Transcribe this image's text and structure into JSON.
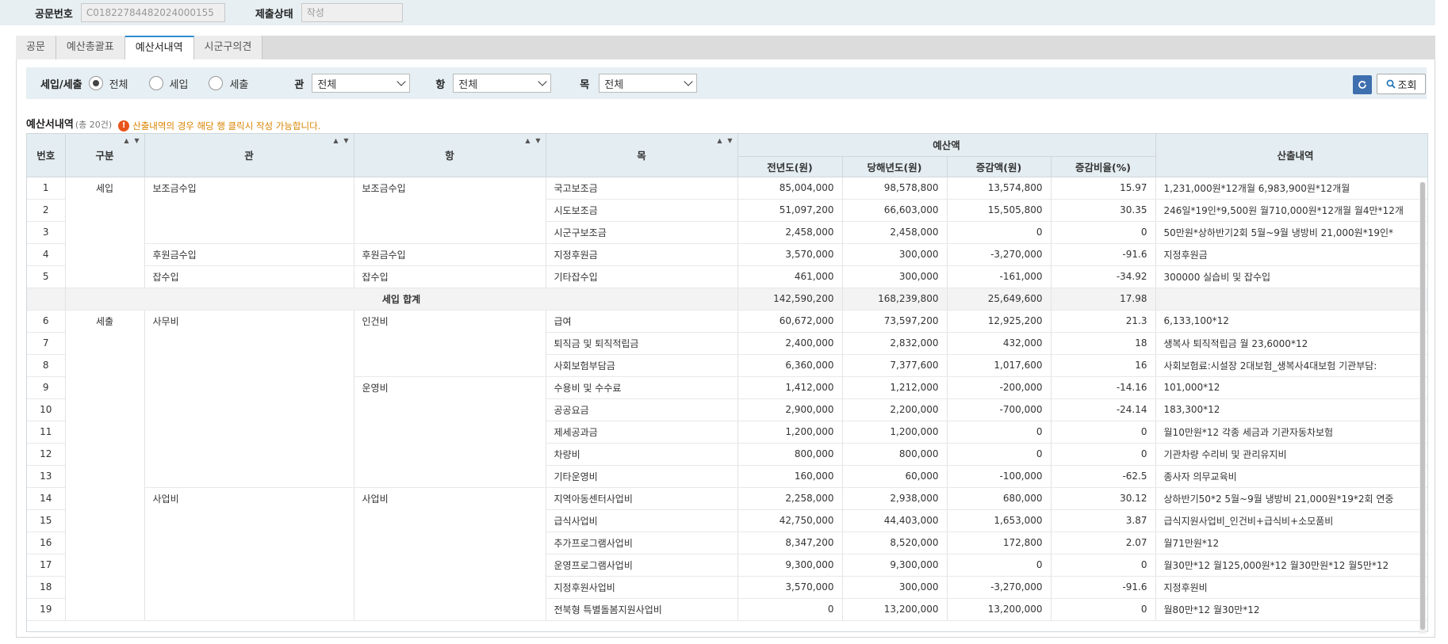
{
  "header": {
    "doc_label": "공문번호",
    "doc_value": "C01822784482024000155",
    "status_label": "제출상태",
    "status_value": "작성"
  },
  "tabs": [
    {
      "label": "공문",
      "active": false
    },
    {
      "label": "예산총괄표",
      "active": false
    },
    {
      "label": "예산서내역",
      "active": true
    },
    {
      "label": "시군구의견",
      "active": false
    }
  ],
  "filter": {
    "type_label": "세입/세출",
    "radios": [
      {
        "label": "전체",
        "checked": true
      },
      {
        "label": "세입",
        "checked": false
      },
      {
        "label": "세출",
        "checked": false
      }
    ],
    "gwan_label": "관",
    "gwan_value": "전체",
    "hang_label": "항",
    "hang_value": "전체",
    "mok_label": "목",
    "mok_value": "전체",
    "search_label": "조회"
  },
  "section": {
    "title": "예산서내역",
    "count": "(총 20건)",
    "notice": "산출내역의 경우 해당 행 클릭시 작성 가능합니다."
  },
  "grid": {
    "columns": {
      "no": "번호",
      "gubun": "구분",
      "gwan": "관",
      "hang": "항",
      "mok": "목",
      "budget": "예산액",
      "prev": "전년도(원)",
      "curr": "당해년도(원)",
      "diff": "증감액(원)",
      "rate": "증감비율(%)",
      "detail": "산출내역"
    },
    "subtotal_label": "세입 합계",
    "rows": [
      {
        "no": "1",
        "gubun": "세입",
        "gwan": "보조금수입",
        "hang": "보조금수입",
        "mok": "국고보조금",
        "prev": "85,004,000",
        "curr": "98,578,800",
        "diff": "13,574,800",
        "rate": "15.97",
        "detail": "1,231,000원*12개월 6,983,900원*12개월"
      },
      {
        "no": "2",
        "gubun": "",
        "gwan": "",
        "hang": "",
        "mok": "시도보조금",
        "prev": "51,097,200",
        "curr": "66,603,000",
        "diff": "15,505,800",
        "rate": "30.35",
        "detail": "246일*19인*9,500원 월710,000원*12개월 월4만*12개"
      },
      {
        "no": "3",
        "gubun": "",
        "gwan": "",
        "hang": "",
        "mok": "시군구보조금",
        "prev": "2,458,000",
        "curr": "2,458,000",
        "diff": "0",
        "rate": "0",
        "detail": "50만원*상하반기2회 5월~9월 냉방비 21,000원*19인*"
      },
      {
        "no": "4",
        "gubun": "",
        "gwan": "후원금수입",
        "hang": "후원금수입",
        "mok": "지정후원금",
        "prev": "3,570,000",
        "curr": "300,000",
        "diff": "-3,270,000",
        "rate": "-91.6",
        "detail": "지정후원금"
      },
      {
        "no": "5",
        "gubun": "",
        "gwan": "잡수입",
        "hang": "잡수입",
        "mok": "기타잡수입",
        "prev": "461,000",
        "curr": "300,000",
        "diff": "-161,000",
        "rate": "-34.92",
        "detail": "300000 실습비 및 잡수입"
      },
      {
        "subtotal": true,
        "prev": "142,590,200",
        "curr": "168,239,800",
        "diff": "25,649,600",
        "rate": "17.98",
        "detail": ""
      },
      {
        "no": "6",
        "gubun": "세출",
        "gwan": "사무비",
        "hang": "인건비",
        "mok": "급여",
        "prev": "60,672,000",
        "curr": "73,597,200",
        "diff": "12,925,200",
        "rate": "21.3",
        "detail": "6,133,100*12"
      },
      {
        "no": "7",
        "gubun": "",
        "gwan": "",
        "hang": "",
        "mok": "퇴직금 및 퇴직적립금",
        "prev": "2,400,000",
        "curr": "2,832,000",
        "diff": "432,000",
        "rate": "18",
        "detail": "생복사 퇴직적립금 월 23,6000*12"
      },
      {
        "no": "8",
        "gubun": "",
        "gwan": "",
        "hang": "",
        "mok": "사회보험부담금",
        "prev": "6,360,000",
        "curr": "7,377,600",
        "diff": "1,017,600",
        "rate": "16",
        "detail": "사회보험료:시설장 2대보험_생복사4대보험 기관부담:"
      },
      {
        "no": "9",
        "gubun": "",
        "gwan": "",
        "hang": "운영비",
        "mok": "수용비 및 수수료",
        "prev": "1,412,000",
        "curr": "1,212,000",
        "diff": "-200,000",
        "rate": "-14.16",
        "detail": "101,000*12"
      },
      {
        "no": "10",
        "gubun": "",
        "gwan": "",
        "hang": "",
        "mok": "공공요금",
        "prev": "2,900,000",
        "curr": "2,200,000",
        "diff": "-700,000",
        "rate": "-24.14",
        "detail": "183,300*12"
      },
      {
        "no": "11",
        "gubun": "",
        "gwan": "",
        "hang": "",
        "mok": "제세공과금",
        "prev": "1,200,000",
        "curr": "1,200,000",
        "diff": "0",
        "rate": "0",
        "detail": "월10만원*12 각종 세금과 기관자동차보험"
      },
      {
        "no": "12",
        "gubun": "",
        "gwan": "",
        "hang": "",
        "mok": "차량비",
        "prev": "800,000",
        "curr": "800,000",
        "diff": "0",
        "rate": "0",
        "detail": "기관차량 수리비 및 관리유지비"
      },
      {
        "no": "13",
        "gubun": "",
        "gwan": "",
        "hang": "",
        "mok": "기타운영비",
        "prev": "160,000",
        "curr": "60,000",
        "diff": "-100,000",
        "rate": "-62.5",
        "detail": "종사자 의무교육비"
      },
      {
        "no": "14",
        "gubun": "",
        "gwan": "사업비",
        "hang": "사업비",
        "mok": "지역아동센터사업비",
        "prev": "2,258,000",
        "curr": "2,938,000",
        "diff": "680,000",
        "rate": "30.12",
        "detail": "상하반기50*2 5월~9월 냉방비 21,000원*19*2회 연중"
      },
      {
        "no": "15",
        "gubun": "",
        "gwan": "",
        "hang": "",
        "mok": "급식사업비",
        "prev": "42,750,000",
        "curr": "44,403,000",
        "diff": "1,653,000",
        "rate": "3.87",
        "detail": "급식지원사업비_인건비+급식비+소모품비"
      },
      {
        "no": "16",
        "gubun": "",
        "gwan": "",
        "hang": "",
        "mok": "추가프로그램사업비",
        "prev": "8,347,200",
        "curr": "8,520,000",
        "diff": "172,800",
        "rate": "2.07",
        "detail": "월71만원*12"
      },
      {
        "no": "17",
        "gubun": "",
        "gwan": "",
        "hang": "",
        "mok": "운영프로그램사업비",
        "prev": "9,300,000",
        "curr": "9,300,000",
        "diff": "0",
        "rate": "0",
        "detail": "월30만*12 월125,000원*12 월30만원*12 월5만*12"
      },
      {
        "no": "18",
        "gubun": "",
        "gwan": "",
        "hang": "",
        "mok": "지정후원사업비",
        "prev": "3,570,000",
        "curr": "300,000",
        "diff": "-3,270,000",
        "rate": "-91.6",
        "detail": "지정후원비"
      },
      {
        "no": "19",
        "gubun": "",
        "gwan": "",
        "hang": "",
        "mok": "전북형 특별돌봄지원사업비",
        "prev": "0",
        "curr": "13,200,000",
        "diff": "13,200,000",
        "rate": "0",
        "detail": "월80만*12 월30만*12"
      }
    ]
  }
}
